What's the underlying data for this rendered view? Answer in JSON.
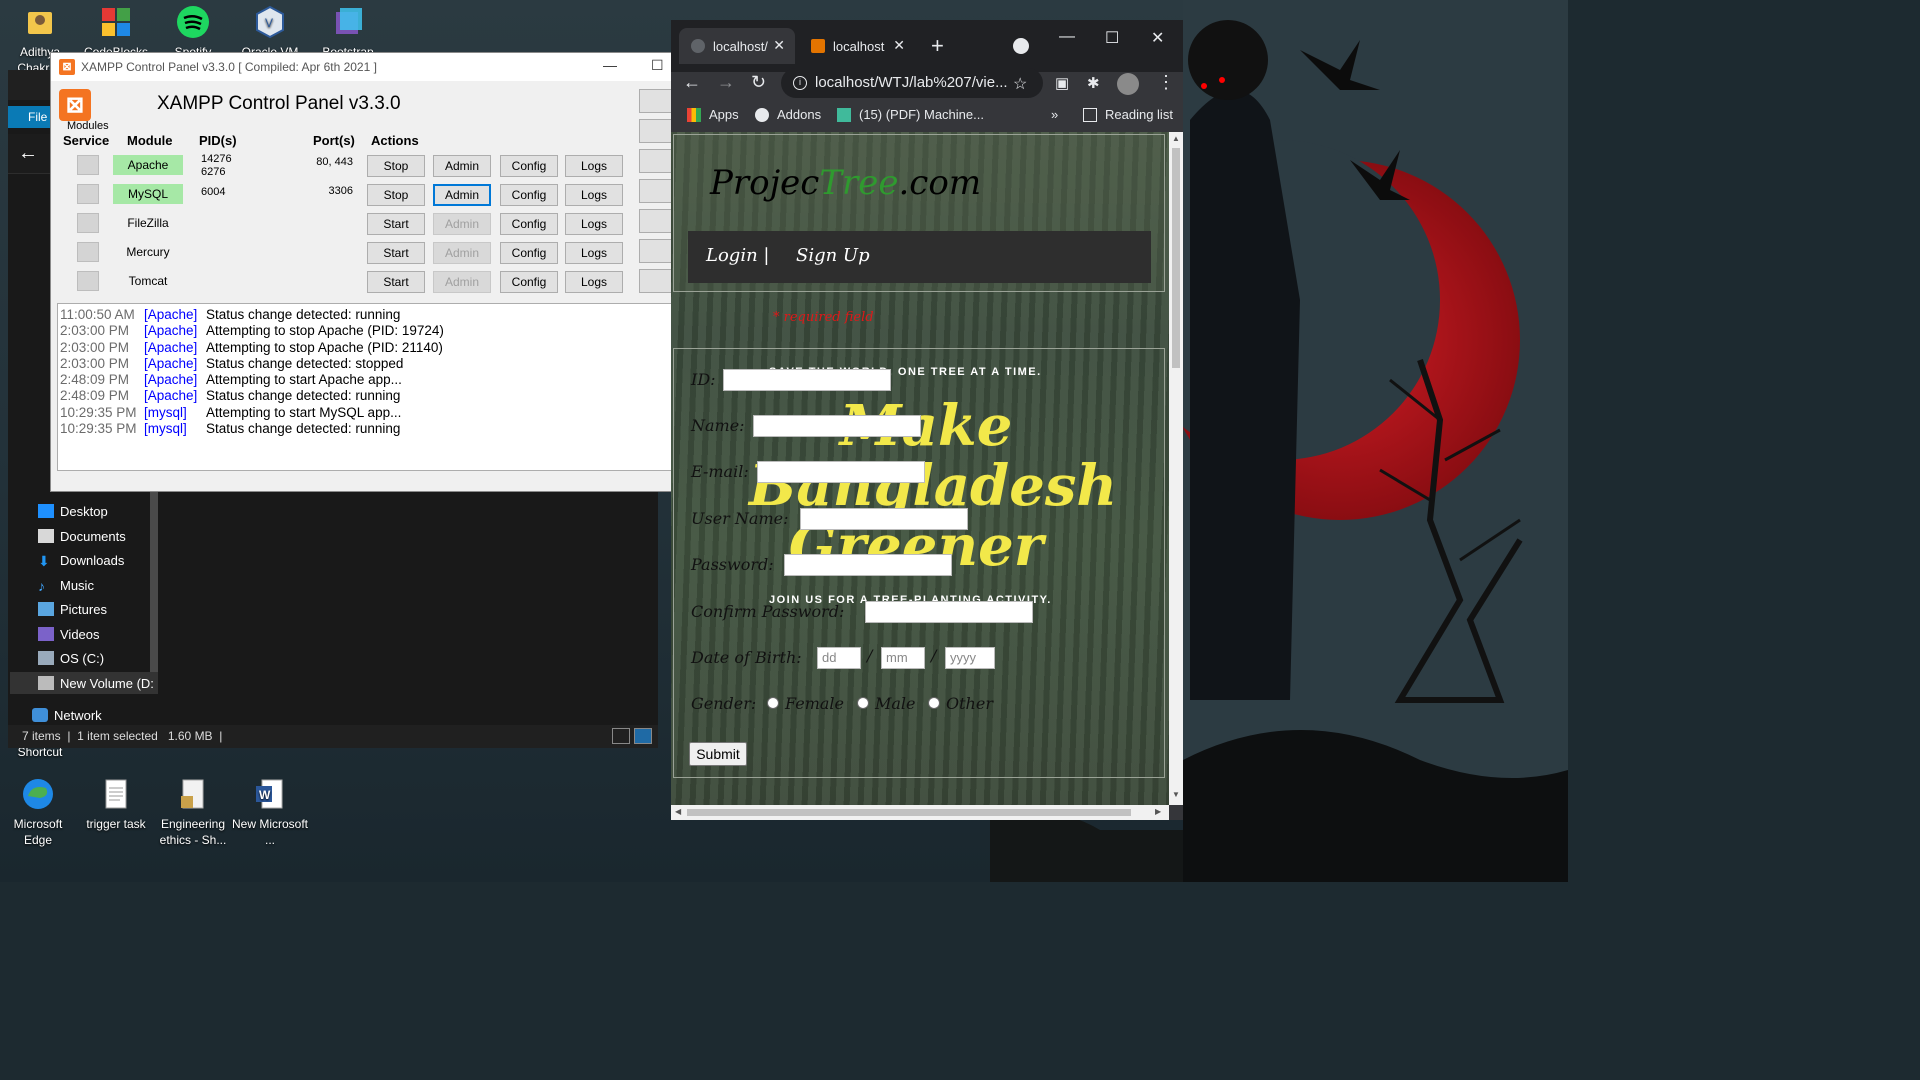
{
  "desktop": {
    "icons_top": [
      {
        "label": "Adithya Chakrab",
        "name": "adithya-folder-icon"
      },
      {
        "label": "CodeBlocks",
        "name": "codeblocks-icon"
      },
      {
        "label": "Spotify",
        "name": "spotify-icon"
      },
      {
        "label": "Oracle VM",
        "name": "oracle-vm-icon"
      },
      {
        "label": "Bootstrap",
        "name": "bootstrap-icon"
      }
    ],
    "shortcut_label": "Shortcut",
    "icons_bottom": [
      {
        "label": "Microsoft Edge",
        "name": "edge-icon"
      },
      {
        "label": "trigger task",
        "name": "text-file-icon"
      },
      {
        "label": "Engineering ethics - Sh...",
        "name": "document-icon"
      },
      {
        "label": "New Microsoft ...",
        "name": "word-doc-icon"
      }
    ]
  },
  "explorer": {
    "file_tab": "File",
    "sidebar": [
      "Desktop",
      "Documents",
      "Downloads",
      "Music",
      "Pictures",
      "Videos",
      "OS (C:)",
      "New Volume (D:",
      "Network"
    ],
    "status": {
      "items": "7 items",
      "selected": "1 item selected",
      "size": "1.60 MB"
    }
  },
  "xampp": {
    "window_title": "XAMPP Control Panel v3.3.0   [ Compiled: Apr 6th 2021 ]",
    "heading": "XAMPP Control Panel v3.3.0",
    "modules_label": "Modules",
    "headers": {
      "service": "Service",
      "module": "Module",
      "pids": "PID(s)",
      "ports": "Port(s)",
      "actions": "Actions"
    },
    "rows": [
      {
        "module": "Apache",
        "pid1": "14276",
        "pid2": "6276",
        "ports": "80, 443",
        "action": "Stop",
        "admin": "Admin",
        "config": "Config",
        "logs": "Logs"
      },
      {
        "module": "MySQL",
        "pid1": "6004",
        "pid2": "",
        "ports": "3306",
        "action": "Stop",
        "admin": "Admin",
        "config": "Config",
        "logs": "Logs"
      },
      {
        "module": "FileZilla",
        "pid1": "",
        "pid2": "",
        "ports": "",
        "action": "Start",
        "admin": "Admin",
        "config": "Config",
        "logs": "Logs"
      },
      {
        "module": "Mercury",
        "pid1": "",
        "pid2": "",
        "ports": "",
        "action": "Start",
        "admin": "Admin",
        "config": "Config",
        "logs": "Logs"
      },
      {
        "module": "Tomcat",
        "pid1": "",
        "pid2": "",
        "ports": "",
        "action": "Start",
        "admin": "Admin",
        "config": "Config",
        "logs": "Logs"
      }
    ],
    "log": [
      {
        "time": "11:00:50 AM",
        "module": "[Apache]",
        "msg": "Status change detected: running"
      },
      {
        "time": "2:03:00 PM",
        "module": "[Apache]",
        "msg": "Attempting to stop Apache (PID: 19724)"
      },
      {
        "time": "2:03:00 PM",
        "module": "[Apache]",
        "msg": "Attempting to stop Apache (PID: 21140)"
      },
      {
        "time": "2:03:00 PM",
        "module": "[Apache]",
        "msg": "Status change detected: stopped"
      },
      {
        "time": "2:48:09 PM",
        "module": "[Apache]",
        "msg": "Attempting to start Apache app..."
      },
      {
        "time": "2:48:09 PM",
        "module": "[Apache]",
        "msg": "Status change detected: running"
      },
      {
        "time": "10:29:35 PM",
        "module": "[mysql]",
        "msg": "Attempting to start MySQL app..."
      },
      {
        "time": "10:29:35 PM",
        "module": "[mysql]",
        "msg": "Status change detected: running"
      }
    ]
  },
  "chrome": {
    "tabs": [
      {
        "title": "localhost/",
        "active": true
      },
      {
        "title": "localhost",
        "active": false
      }
    ],
    "url": "localhost/WTJ/lab%207/vie...",
    "bookmarks": {
      "apps": "Apps",
      "addons": "Addons",
      "pdf": "(15) (PDF) Machine...",
      "more": "»",
      "reading_list": "Reading list"
    }
  },
  "page": {
    "logo_part1": "Projec",
    "logo_part2": "Tree",
    "logo_part3": ".com",
    "nav_login": "Login |",
    "nav_signup": "Sign Up",
    "required_note": "* required field",
    "tagline_top": "SAVE THE WORLD, ONE TREE AT A TIME.",
    "big_text_1": "Make",
    "big_text_2": "Bangladesh",
    "big_text_3": "Greener",
    "tagline_bottom": "JOIN US FOR A TREE-PLANTING ACTIVITY.",
    "fields": {
      "id": "ID:",
      "name": "Name:",
      "email": "E-mail:",
      "username": "User Name:",
      "password": "Password:",
      "confirm": "Confirm Password:",
      "dob": "Date of Birth:",
      "gender": "Gender:"
    },
    "dob_placeholders": {
      "dd": "dd",
      "mm": "mm",
      "yyyy": "yyyy"
    },
    "dob_sep": "/",
    "gender_options": [
      "Female",
      "Male",
      "Other"
    ],
    "submit": "Submit"
  }
}
